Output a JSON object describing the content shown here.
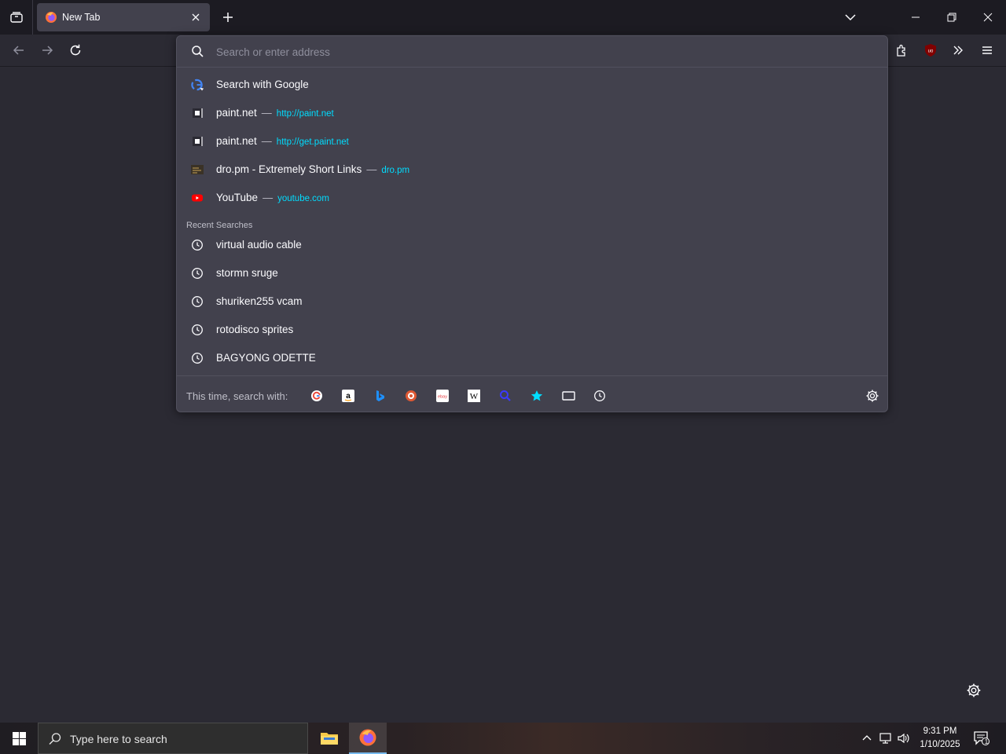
{
  "browser": {
    "tab": {
      "title": "New Tab"
    }
  },
  "urlbar": {
    "placeholder": "Search or enter address",
    "results": [
      {
        "title": "Search with Google",
        "icon": "google-icon"
      },
      {
        "title": "paint.net",
        "url": "http://paint.net",
        "icon": "page-icon"
      },
      {
        "title": "paint.net",
        "url": "http://get.paint.net",
        "icon": "page-icon"
      },
      {
        "title": "dro.pm - Extremely Short Links",
        "url": "dro.pm",
        "icon": "dropm-icon"
      },
      {
        "title": "YouTube",
        "url": "youtube.com",
        "icon": "youtube-icon"
      }
    ],
    "separator": "—",
    "recent_label": "Recent Searches",
    "recent": [
      "virtual audio cable",
      "stormn sruge",
      "shuriken255 vcam",
      "rotodisco sprites",
      "BAGYONG ODETTE"
    ],
    "oneoff_label": "This time, search with:",
    "oneoff_engines": [
      "google",
      "amazon",
      "bing",
      "duckduckgo",
      "ebay",
      "wikipedia",
      "search",
      "bookmarks",
      "tabs",
      "history"
    ]
  },
  "taskbar": {
    "search_placeholder": "Type here to search",
    "time": "9:31 PM",
    "date": "1/10/2025",
    "notification_count": "1"
  },
  "colors": {
    "accent_url": "#00ddff",
    "popup_bg": "#42414d",
    "page_bg": "#2b2a33",
    "tabbar_bg": "#1c1b22"
  }
}
